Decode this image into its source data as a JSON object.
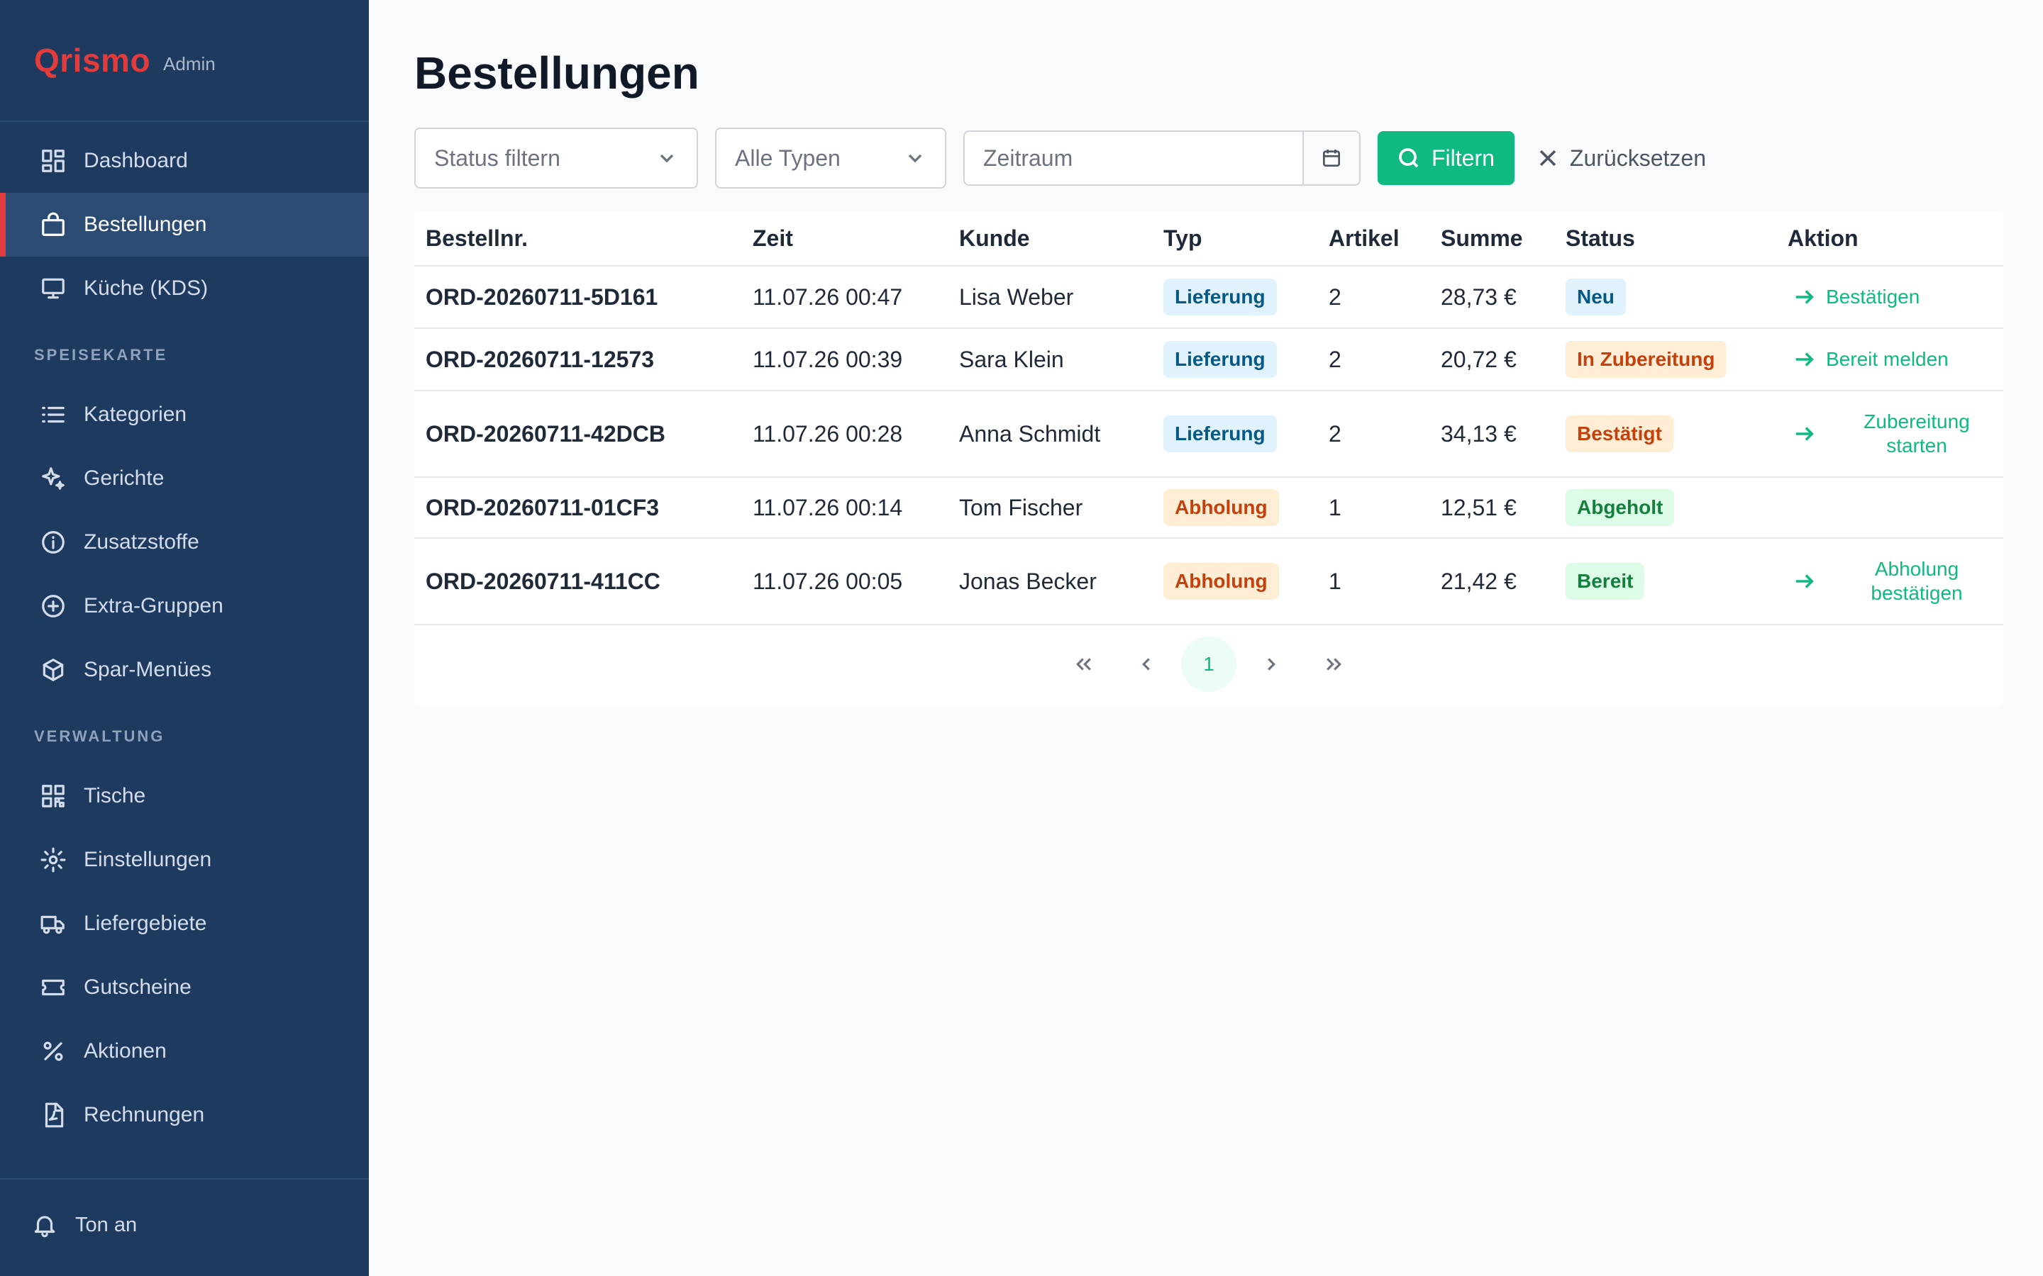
{
  "brand": {
    "name": "Qrismo",
    "sub": "Admin"
  },
  "sidebar": {
    "main": [
      {
        "label": "Dashboard",
        "icon": "dashboard-icon"
      },
      {
        "label": "Bestellungen",
        "icon": "shopping-bag-icon"
      },
      {
        "label": "Küche (KDS)",
        "icon": "monitor-icon"
      }
    ],
    "section_menu": "SPEISEKARTE",
    "menu": [
      {
        "label": "Kategorien",
        "icon": "list-icon"
      },
      {
        "label": "Gerichte",
        "icon": "sparkles-icon"
      },
      {
        "label": "Zusatzstoffe",
        "icon": "info-icon"
      },
      {
        "label": "Extra-Gruppen",
        "icon": "plus-circle-icon"
      },
      {
        "label": "Spar-Menües",
        "icon": "box-icon"
      }
    ],
    "section_admin": "VERWALTUNG",
    "admin": [
      {
        "label": "Tische",
        "icon": "qr-code-icon"
      },
      {
        "label": "Einstellungen",
        "icon": "gear-icon"
      },
      {
        "label": "Liefergebiete",
        "icon": "truck-icon"
      },
      {
        "label": "Gutscheine",
        "icon": "ticket-icon"
      },
      {
        "label": "Aktionen",
        "icon": "percent-icon"
      },
      {
        "label": "Rechnungen",
        "icon": "file-pdf-icon"
      }
    ],
    "footer": {
      "label": "Ton an",
      "icon": "bell-icon"
    }
  },
  "page": {
    "title": "Bestellungen"
  },
  "filters": {
    "status_placeholder": "Status filtern",
    "type_value": "Alle Typen",
    "date_placeholder": "Zeitraum",
    "filter_label": "Filtern",
    "reset_label": "Zurücksetzen"
  },
  "table": {
    "headers": {
      "id": "Bestellnr.",
      "time": "Zeit",
      "customer": "Kunde",
      "type": "Typ",
      "items": "Artikel",
      "sum": "Summe",
      "status": "Status",
      "action": "Aktion"
    },
    "rows": [
      {
        "id": "ORD-20260711-5D161",
        "time": "11.07.26 00:47",
        "customer": "Lisa Weber",
        "type": "Lieferung",
        "items": "2",
        "sum": "28,73 €",
        "status": "Neu",
        "action_l1": "Bestätigen",
        "action_l2": ""
      },
      {
        "id": "ORD-20260711-12573",
        "time": "11.07.26 00:39",
        "customer": "Sara Klein",
        "type": "Lieferung",
        "items": "2",
        "sum": "20,72 €",
        "status": "In Zubereitung",
        "action_l1": "Bereit melden",
        "action_l2": ""
      },
      {
        "id": "ORD-20260711-42DCB",
        "time": "11.07.26 00:28",
        "customer": "Anna Schmidt",
        "type": "Lieferung",
        "items": "2",
        "sum": "34,13 €",
        "status": "Bestätigt",
        "action_l1": "Zubereitung",
        "action_l2": "starten"
      },
      {
        "id": "ORD-20260711-01CF3",
        "time": "11.07.26 00:14",
        "customer": "Tom Fischer",
        "type": "Abholung",
        "items": "1",
        "sum": "12,51 €",
        "status": "Abgeholt",
        "action_l1": "",
        "action_l2": ""
      },
      {
        "id": "ORD-20260711-411CC",
        "time": "11.07.26 00:05",
        "customer": "Jonas Becker",
        "type": "Abholung",
        "items": "1",
        "sum": "21,42 €",
        "status": "Bereit",
        "action_l1": "Abholung",
        "action_l2": "bestätigen"
      }
    ]
  },
  "pagination": {
    "current": "1"
  },
  "colors": {
    "sidebar_bg": "#1e3a5f",
    "brand_red": "#e23b3b",
    "accent_green": "#10b981",
    "badge_blue": "#e0f2fe",
    "badge_orange": "#ffedd5",
    "badge_green": "#dcfce7"
  }
}
